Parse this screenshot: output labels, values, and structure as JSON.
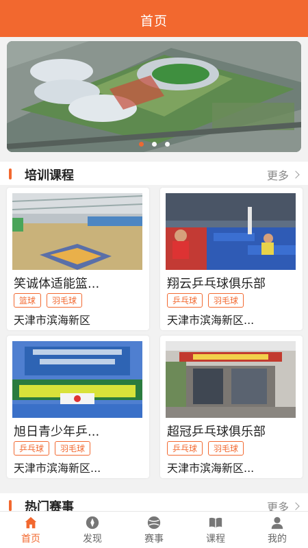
{
  "header": {
    "title": "首页"
  },
  "banner": {
    "dots": 3,
    "active_index": 0
  },
  "sections": {
    "training": {
      "title": "培训课程",
      "more": "更多"
    },
    "events": {
      "title": "热门赛事",
      "more": "更多"
    }
  },
  "courses": [
    {
      "name": "笑诚体适能篮...",
      "tags": [
        "篮球",
        "羽毛球"
      ],
      "address": "天津市滨海新区"
    },
    {
      "name": "翔云乒乓球俱乐部",
      "tags": [
        "乒乓球",
        "羽毛球"
      ],
      "address": "天津市滨海新区..."
    },
    {
      "name": "旭日青少年乒...",
      "tags": [
        "乒乓球",
        "羽毛球"
      ],
      "address": "天津市滨海新区..."
    },
    {
      "name": "超冠乒乓球俱乐部",
      "tags": [
        "乒乓球",
        "羽毛球"
      ],
      "address": "天津市滨海新区..."
    }
  ],
  "tabbar": [
    {
      "label": "首页",
      "icon": "home-icon",
      "active": true
    },
    {
      "label": "发现",
      "icon": "compass-icon",
      "active": false
    },
    {
      "label": "赛事",
      "icon": "ball-icon",
      "active": false
    },
    {
      "label": "课程",
      "icon": "book-icon",
      "active": false
    },
    {
      "label": "我的",
      "icon": "user-icon",
      "active": false
    }
  ],
  "colors": {
    "accent": "#f2682f"
  }
}
